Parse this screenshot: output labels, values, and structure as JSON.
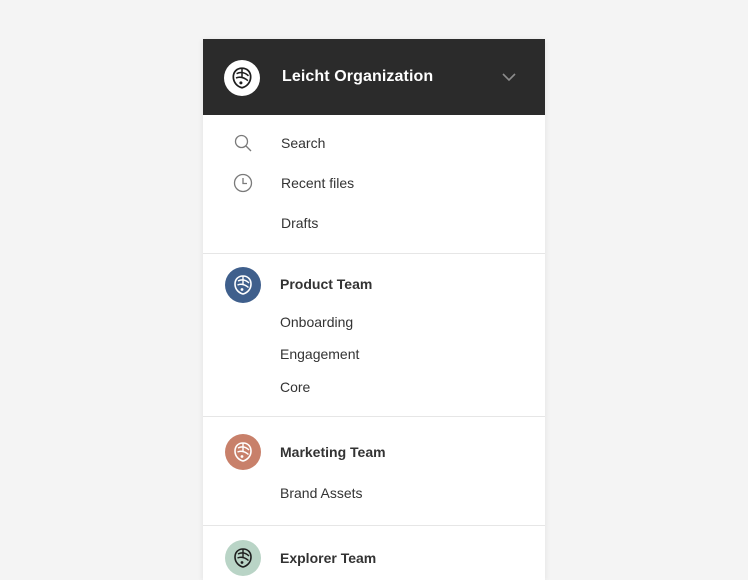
{
  "org": {
    "name": "Leicht Organization",
    "logo_icon": "org-logo-icon",
    "dropdown_icon": "chevron-down-icon"
  },
  "nav": [
    {
      "label": "Search",
      "icon": "search-icon"
    },
    {
      "label": "Recent files",
      "icon": "clock-icon"
    },
    {
      "label": "Drafts",
      "icon": ""
    }
  ],
  "teams": [
    {
      "name": "Product Team",
      "color": "#3f5f8c",
      "items": [
        "Onboarding",
        "Engagement",
        "Core"
      ]
    },
    {
      "name": "Marketing Team",
      "color": "#c8806a",
      "items": [
        "Brand Assets"
      ]
    },
    {
      "name": "Explorer Team",
      "color": "#b9d4c6",
      "items": []
    }
  ],
  "colors": {
    "header_bg": "#2b2b2b",
    "panel_bg": "#ffffff",
    "page_bg": "#f4f4f4",
    "text": "#333333"
  }
}
